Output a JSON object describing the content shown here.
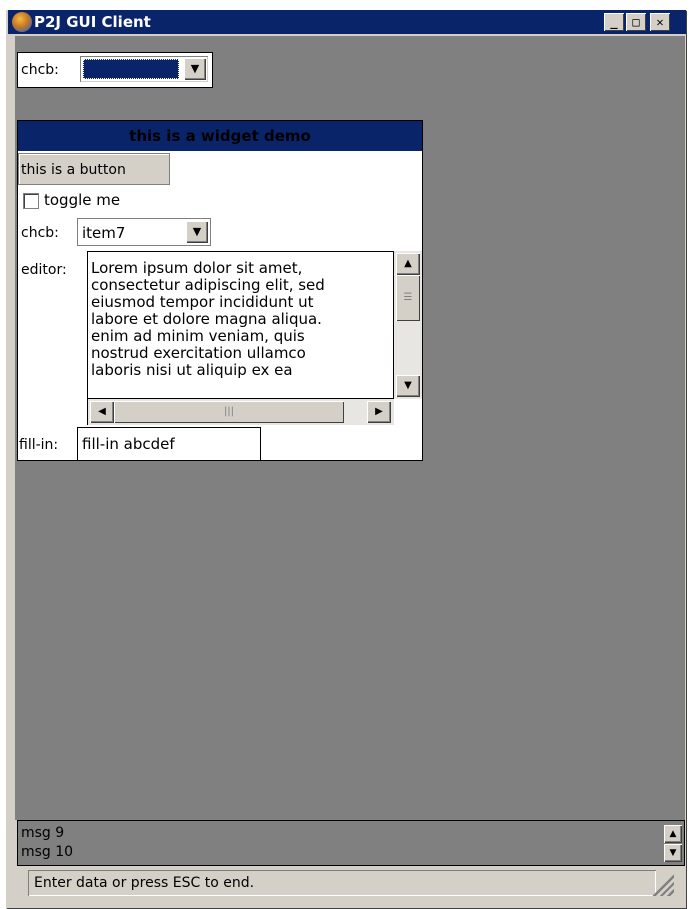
{
  "window": {
    "title": "P2J GUI Client",
    "minimize_glyph": "_",
    "maximize_glyph": "□",
    "close_glyph": "✕"
  },
  "top_bar": {
    "chcb_label": "chcb:",
    "chcb_value": ""
  },
  "widget_demo": {
    "title": "this is a widget demo",
    "button_label": "this is a button",
    "toggle_label": "toggle me",
    "toggle_checked": false,
    "chcb_label": "chcb:",
    "chcb_value": "item7",
    "editor_label": "editor:",
    "editor_text": "Lorem ipsum dolor sit amet,\nconsectetur adipiscing elit, sed\neiusmod tempor incididunt ut\nlabore et dolore magna aliqua.\nenim ad minim veniam, quis\nnostrud exercitation ullamco\nlaboris nisi ut aliquip ex ea",
    "fill_in_label": "fill-in:",
    "fill_in_value": "fill-in abcdef"
  },
  "messages": [
    "msg 9",
    "msg 10"
  ],
  "status": {
    "text": "Enter data or press ESC to end."
  },
  "colors": {
    "title_bar": "#0a246a",
    "client_bg": "#808080",
    "chrome": "#d4d0c8"
  }
}
